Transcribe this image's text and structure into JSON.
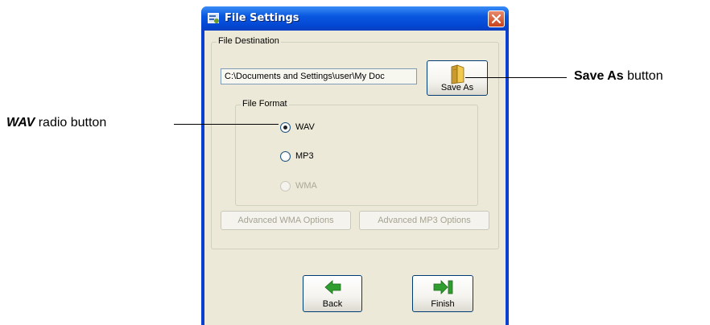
{
  "window": {
    "title": "File Settings",
    "app_icon": "settings-app-icon",
    "close_icon": "close-icon"
  },
  "destination": {
    "group_label": "File Destination",
    "path_value": "C:\\Documents and Settings\\user\\My Doc",
    "save_as_label": "Save As",
    "save_as_icon": "folder-icon"
  },
  "format": {
    "group_label": "File Format",
    "options": [
      {
        "label": "WAV",
        "checked": true,
        "enabled": true
      },
      {
        "label": "MP3",
        "checked": false,
        "enabled": true
      },
      {
        "label": "WMA",
        "checked": false,
        "enabled": false
      }
    ]
  },
  "advanced": {
    "wma_label": "Advanced WMA Options",
    "mp3_label": "Advanced MP3 Options"
  },
  "nav": {
    "back_label": "Back",
    "back_icon": "arrow-left-icon",
    "finish_label": "Finish",
    "finish_icon": "arrow-right-finish-icon"
  },
  "callouts": {
    "save_as_bold": "Save As",
    "save_as_rest": " button",
    "wav_bold": "WAV",
    "wav_rest": " radio button"
  },
  "colors": {
    "titlebar": "#0a58e0",
    "dialog_bg": "#ece9d8",
    "close_button": "#c8421c",
    "arrow_green": "#2e9e2e"
  }
}
